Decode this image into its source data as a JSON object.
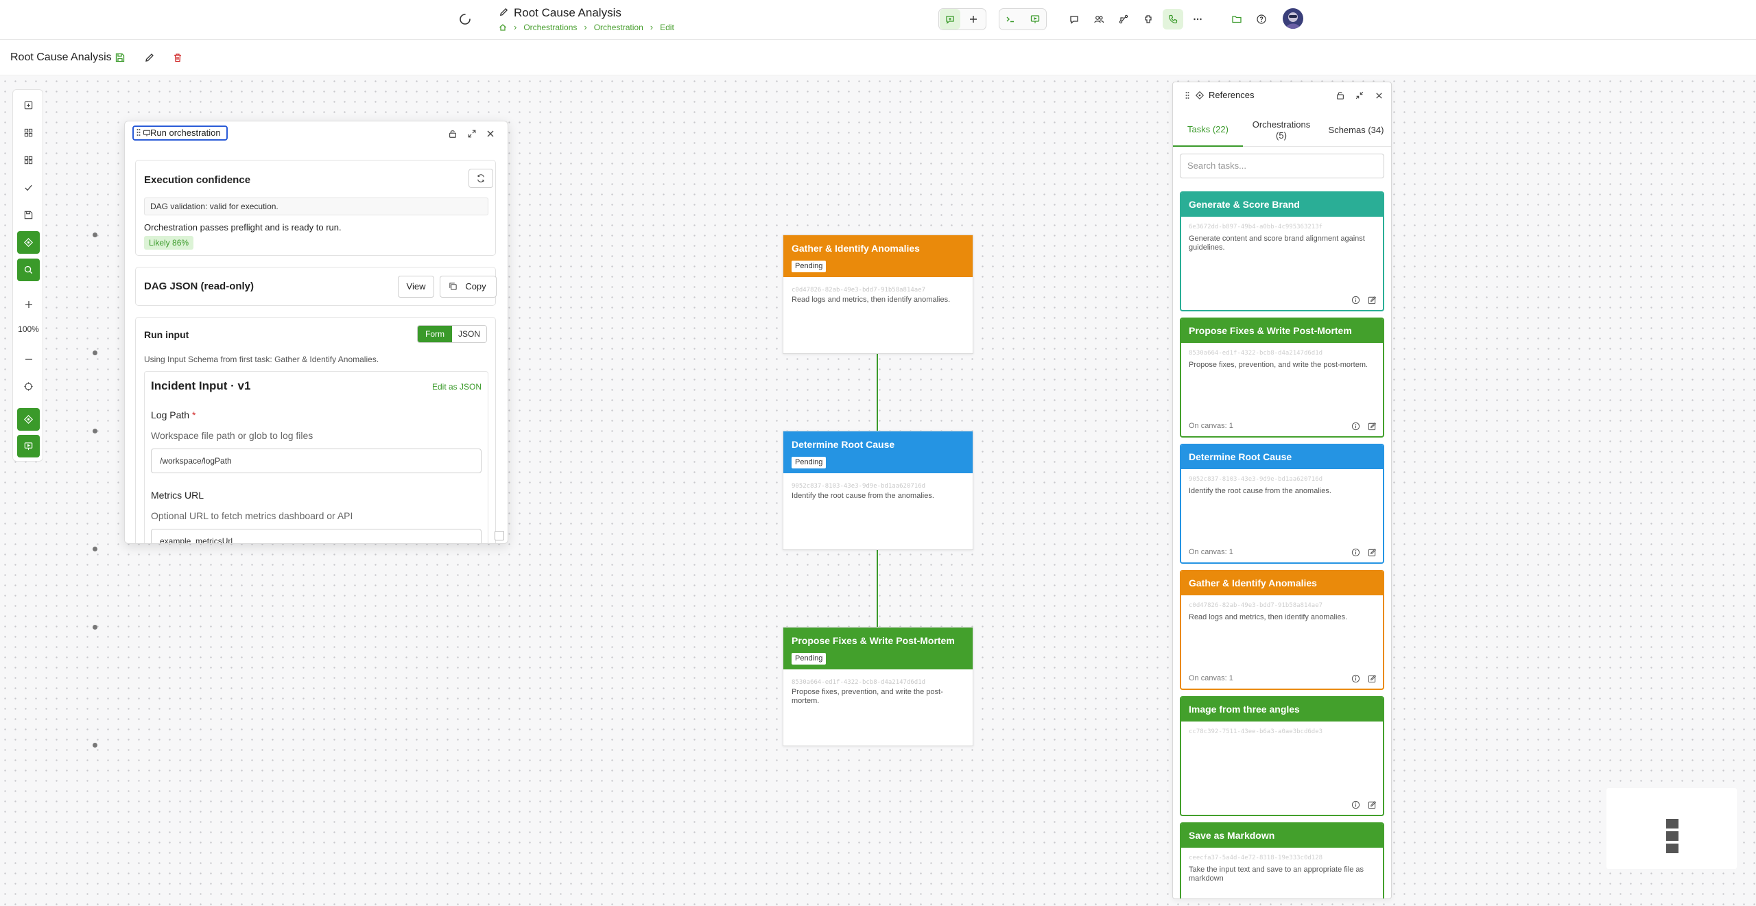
{
  "header": {
    "title": "Root Cause Analysis",
    "breadcrumb": [
      "Orchestrations",
      "Orchestration",
      "Edit"
    ]
  },
  "subbar": {
    "title": "Root Cause Analysis"
  },
  "left_toolbar": {
    "zoom": "100%"
  },
  "run_panel": {
    "tab_label": "Run orchestration",
    "confidence": {
      "title": "Execution confidence",
      "validation": "DAG validation: valid for execution.",
      "status_text": "Orchestration passes preflight and is ready to run.",
      "badge": "Likely 86%"
    },
    "dag_json": {
      "title": "DAG JSON (read-only)",
      "view_label": "View",
      "copy_label": "Copy"
    },
    "run_input": {
      "title": "Run input",
      "mode_form": "Form",
      "mode_json": "JSON",
      "hint": "Using Input Schema from first task: Gather & Identify Anomalies.",
      "schema_title": "Incident Input · v1",
      "edit_as_json": "Edit as JSON",
      "fields": [
        {
          "label": "Log Path",
          "required_mark": "*",
          "description": "Workspace file path or glob to log files",
          "value": "/workspace/logPath"
        },
        {
          "label": "Metrics URL",
          "description": "Optional URL to fetch metrics dashboard or API",
          "value": "example_metricsUrl"
        }
      ]
    }
  },
  "nodes": [
    {
      "title": "Gather & Identify Anomalies",
      "status": "Pending",
      "id": "c0d47826-82ab-49e3-bdd7-91b58a814ae7",
      "description": "Read logs and metrics, then identify anomalies.",
      "color": "#ea8a0b"
    },
    {
      "title": "Determine Root Cause",
      "status": "Pending",
      "id": "9052c837-8103-43e3-9d9e-bd1aa620716d",
      "description": "Identify the root cause from the anomalies.",
      "color": "#2594e3"
    },
    {
      "title": "Propose Fixes & Write Post-Mortem",
      "status": "Pending",
      "id": "8530a664-ed1f-4322-bcb8-d4a2147d6d1d",
      "description": "Propose fixes, prevention, and write the post-mortem.",
      "color": "#43a02c"
    }
  ],
  "references": {
    "title": "References",
    "tabs": [
      "Tasks (22)",
      "Orchestrations (5)",
      "Schemas (34)"
    ],
    "search_placeholder": "Search tasks...",
    "cards": [
      {
        "title": "Generate & Score Brand",
        "id": "6e3672dd-b897-49b4-a0bb-4c995363213f",
        "description": "Generate content and score brand alignment against guidelines.",
        "on_canvas": "",
        "color": "#2aae96"
      },
      {
        "title": "Propose Fixes & Write Post-Mortem",
        "id": "8530a664-ed1f-4322-bcb8-d4a2147d6d1d",
        "description": "Propose fixes, prevention, and write the post-mortem.",
        "on_canvas": "On canvas: 1",
        "color": "#43a02c"
      },
      {
        "title": "Determine Root Cause",
        "id": "9052c837-8103-43e3-9d9e-bd1aa620716d",
        "description": "Identify the root cause from the anomalies.",
        "on_canvas": "On canvas: 1",
        "color": "#2594e3"
      },
      {
        "title": "Gather & Identify Anomalies",
        "id": "c0d47826-82ab-49e3-bdd7-91b58a814ae7",
        "description": "Read logs and metrics, then identify anomalies.",
        "on_canvas": "On canvas: 1",
        "color": "#ea8a0b"
      },
      {
        "title": "Image from three angles",
        "id": "cc78c392-7511-43ee-b6a3-a0ae3bcd6de3",
        "description": "",
        "on_canvas": "",
        "color": "#43a02c"
      },
      {
        "title": "Save as Markdown",
        "id": "ceecfa37-5a4d-4e72-8318-19e333c0d128",
        "description": "Take the input text and save to an appropriate file as markdown",
        "on_canvas": "",
        "color": "#43a02c"
      }
    ]
  },
  "colors": {
    "accent": "#3a9a2a",
    "focus": "#2a5bd7",
    "danger": "#d02a2a"
  }
}
